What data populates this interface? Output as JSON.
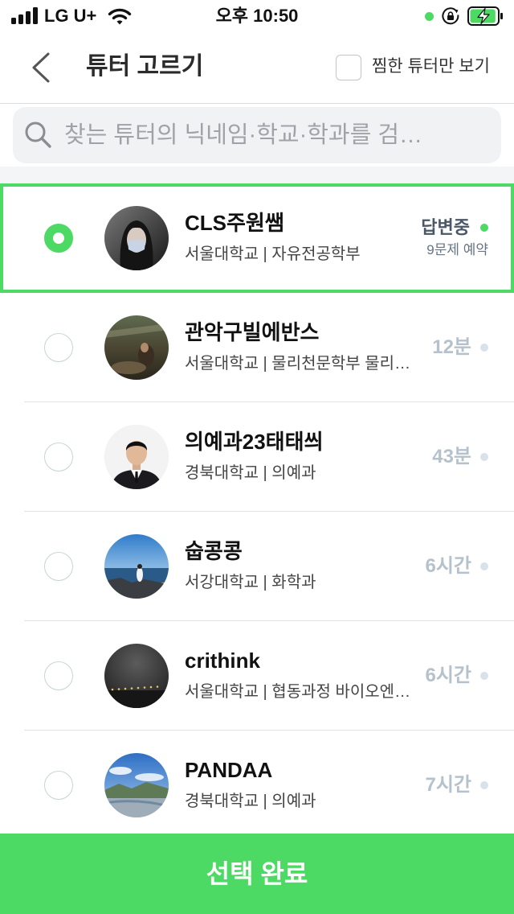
{
  "status_bar": {
    "carrier": "LG U+",
    "time": "오후 10:50",
    "battery_level": 0.95,
    "battery_charging": true
  },
  "header": {
    "title": "튜터 고르기",
    "filter_label": "찜한 튜터만 보기",
    "filter_checked": false
  },
  "search": {
    "placeholder": "찾는 튜터의 닉네임·학교·학과를 검…"
  },
  "tutors": [
    {
      "name": "CLS주원쌤",
      "info": "서울대학교 | 자유전공학부",
      "status": "답변중",
      "reservation": "9문제 예약",
      "selected": true
    },
    {
      "name": "관악구빌에반스",
      "info": "서울대학교 | 물리천문학부 물리…",
      "time": "12분",
      "selected": false
    },
    {
      "name": "의예과23태태씌",
      "info": "경북대학교 | 의예과",
      "time": "43분",
      "selected": false
    },
    {
      "name": "숩콩콩",
      "info": "서강대학교 | 화학과",
      "time": "6시간",
      "selected": false
    },
    {
      "name": "crithink",
      "info": "서울대학교 | 협동과정 바이오엔…",
      "time": "6시간",
      "selected": false
    },
    {
      "name": "PANDAA",
      "info": "경북대학교 | 의예과",
      "time": "7시간",
      "selected": false
    }
  ],
  "footer": {
    "button_label": "선택 완료"
  },
  "icons": {
    "signal": "signal-icon",
    "wifi": "wifi-icon",
    "orientation_lock": "orientation-lock-icon",
    "battery": "battery-charging-icon",
    "back": "back-chevron-icon",
    "search": "search-icon",
    "status_dot": "status-dot-icon"
  },
  "colors": {
    "accent": "#4cd964",
    "status_active": "#4cd964",
    "status_idle": "#d9e2ea",
    "time_text": "#b5c2cb",
    "status_text": "#4a5766"
  }
}
